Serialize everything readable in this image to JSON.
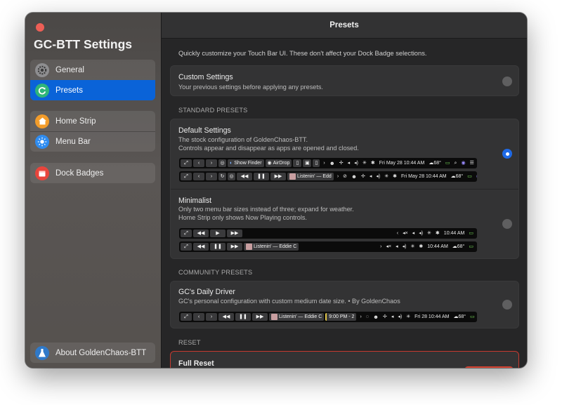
{
  "app": {
    "title": "GC-BTT Settings"
  },
  "sidebar": {
    "group1": [
      {
        "label": "General",
        "icon": "gear-icon"
      },
      {
        "label": "Presets",
        "icon": "refresh-icon"
      }
    ],
    "group2": [
      {
        "label": "Home Strip",
        "icon": "home-icon"
      },
      {
        "label": "Menu Bar",
        "icon": "sun-icon"
      }
    ],
    "group3": [
      {
        "label": "Dock Badges",
        "icon": "calendar-icon"
      }
    ],
    "about": {
      "label": "About GoldenChaos-BTT",
      "icon": "flask-icon"
    }
  },
  "header": {
    "title": "Presets"
  },
  "intro": "Quickly customize your Touch Bar UI. These don't affect your Dock Badge selections.",
  "custom": {
    "title": "Custom Settings",
    "desc": "Your previous settings before applying any presets."
  },
  "standard": {
    "heading": "STANDARD PRESETS",
    "default": {
      "title": "Default Settings",
      "desc1": "The stock configuration of GoldenChaos-BTT.",
      "desc2": "Controls appear and disappear as apps are opened and closed."
    },
    "minimalist": {
      "title": "Minimalist",
      "desc1": "Only two menu bar sizes instead of three; expand for weather.",
      "desc2": "Home Strip only shows Now Playing controls."
    }
  },
  "community": {
    "heading": "COMMUNITY PRESETS",
    "daily": {
      "title": "GC's Daily Driver",
      "desc": "GC's personal configuration with custom medium date size. • By GoldenChaos"
    }
  },
  "reset": {
    "heading": "RESET",
    "title": "Full Reset"
  },
  "touchbar": {
    "show_finder": "Show Finder",
    "airdrop": "AirDrop",
    "listening": "Listenin' — Edd",
    "listening_full": "Listenin' — Eddie C",
    "date_default": "Fri May 28 10:44 AM",
    "time": "10:44 AM",
    "temp": "68°",
    "time_range": "9:00 PM - 2",
    "date_daily": "Fri 28 10:44 AM"
  },
  "colors": {
    "accent": "#0a63d8",
    "danger": "#d94332",
    "radio_on": "#1f6ae6"
  }
}
